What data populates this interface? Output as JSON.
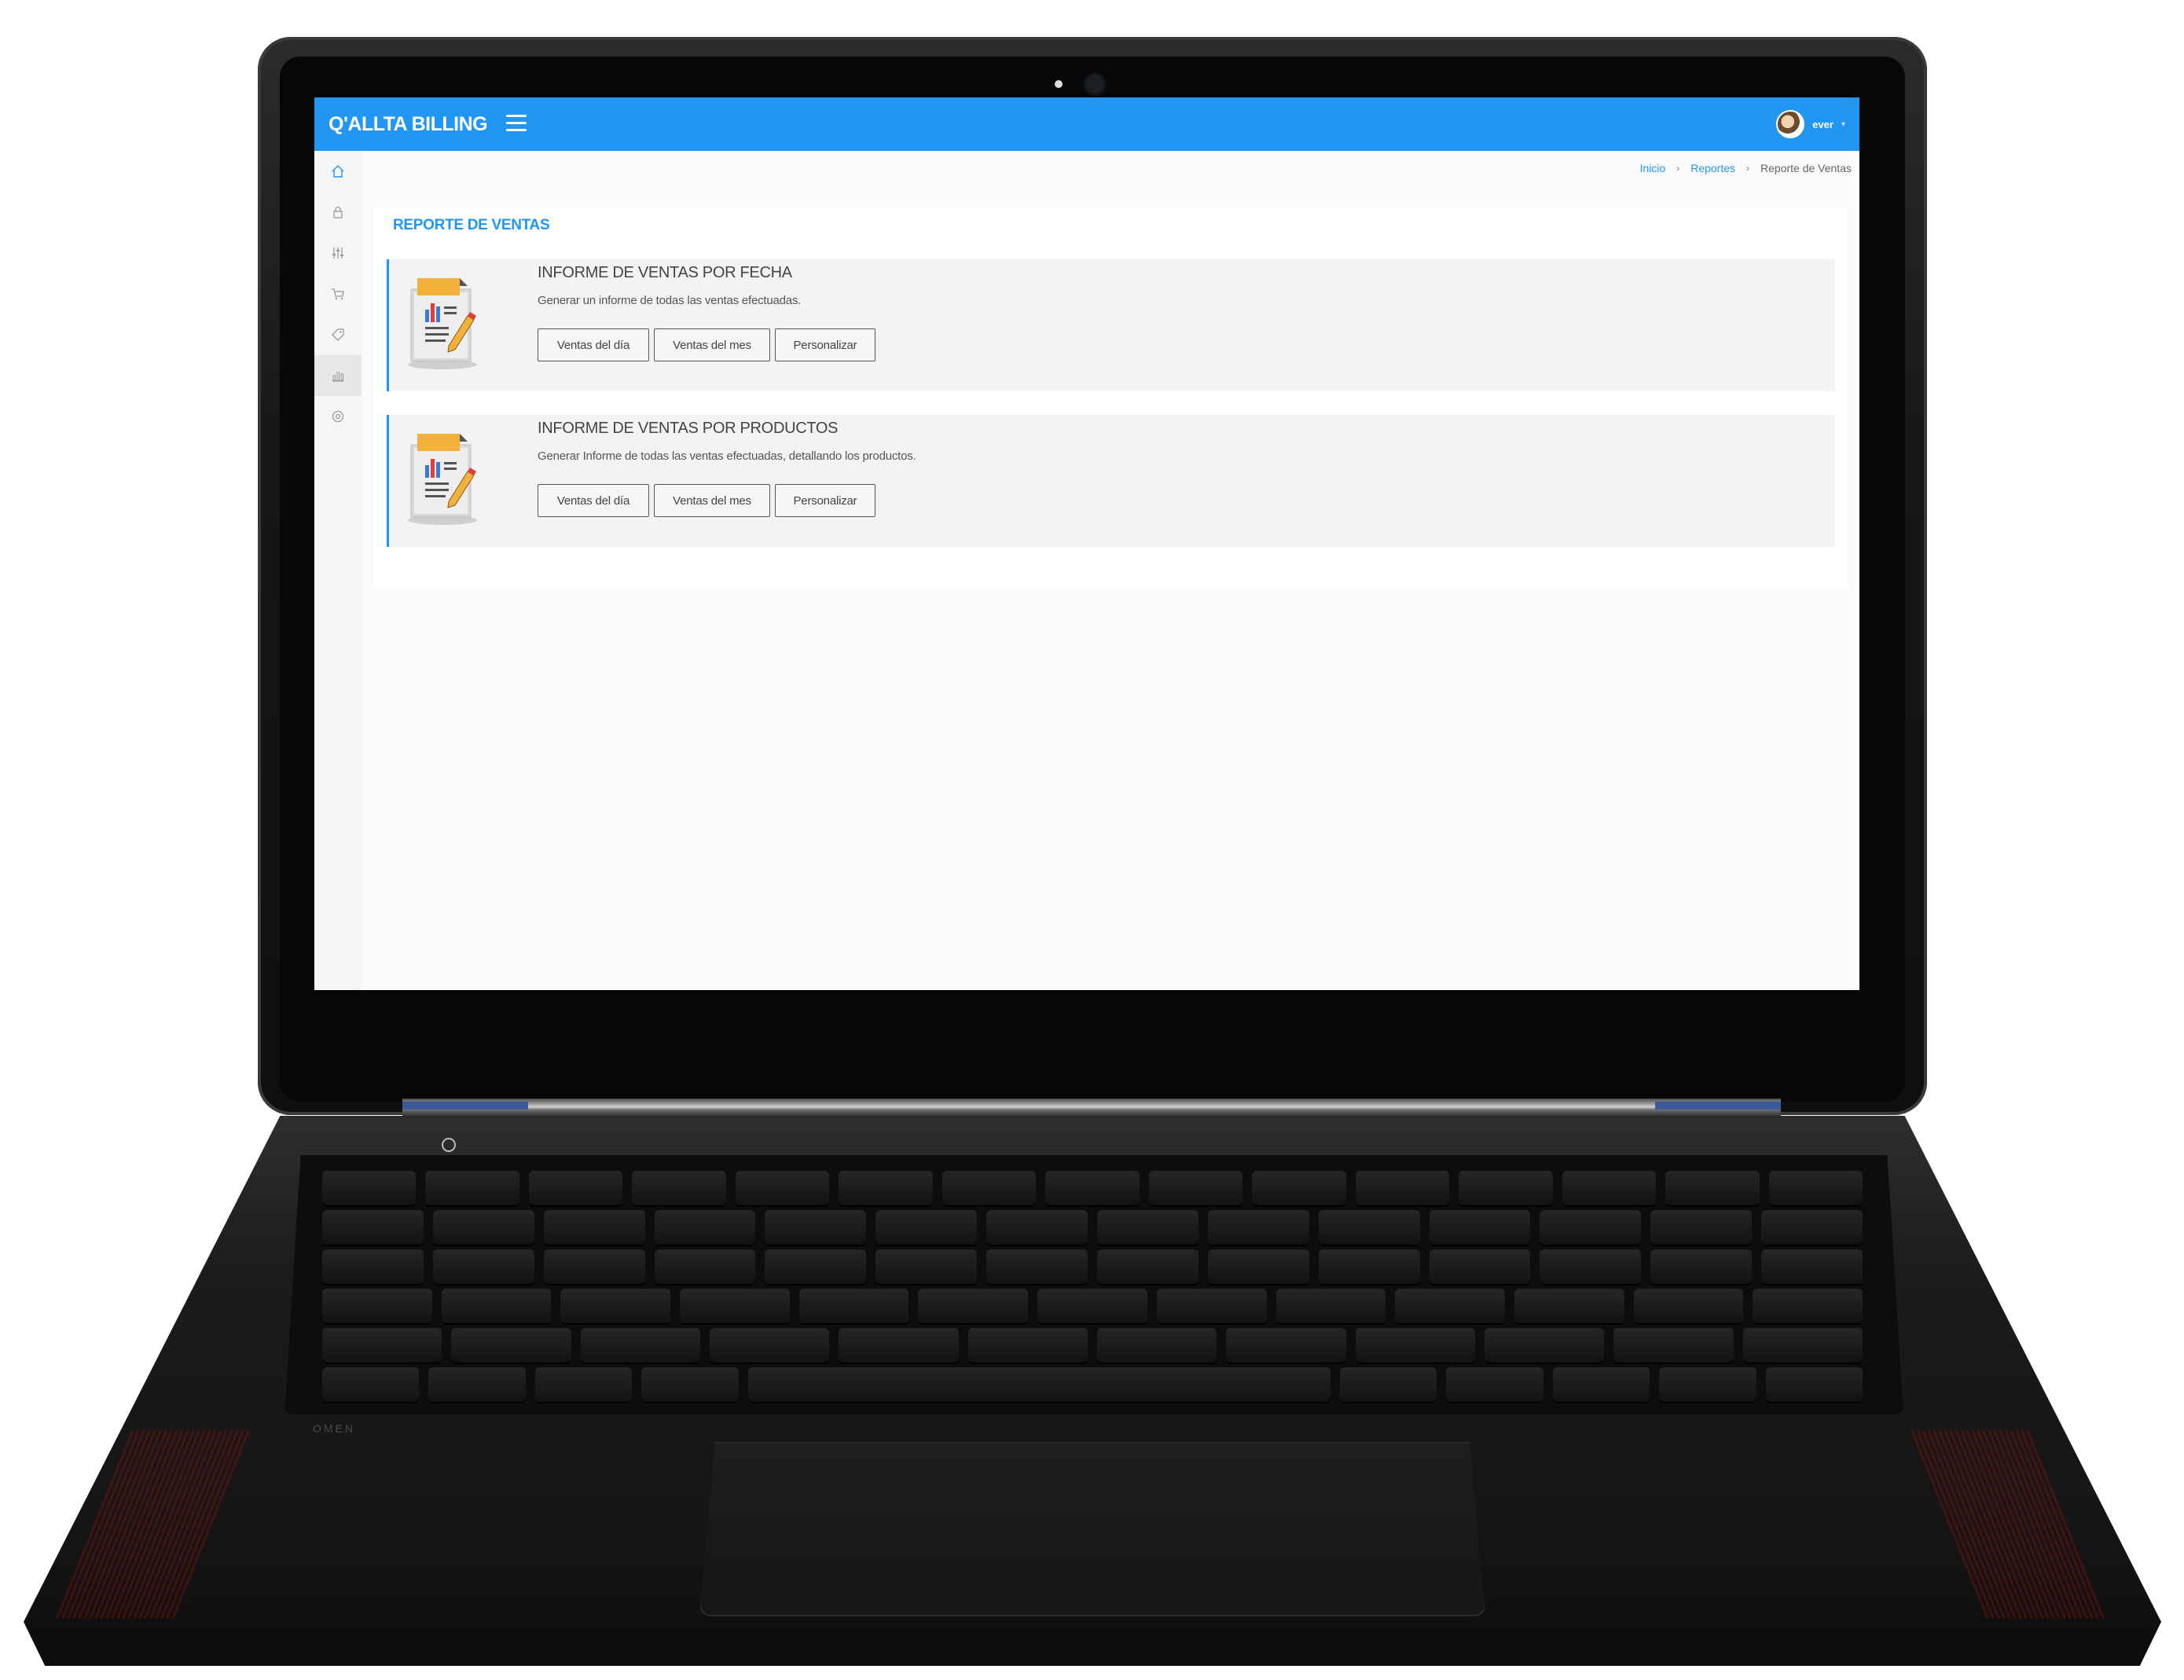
{
  "app": {
    "brand": "Q'ALLTA BILLING",
    "user_name": "ever",
    "caret": "▾"
  },
  "sidebar": {
    "items": [
      {
        "icon": "home-icon"
      },
      {
        "icon": "lock-icon"
      },
      {
        "icon": "sliders-icon"
      },
      {
        "icon": "cart-icon"
      },
      {
        "icon": "tag-icon"
      },
      {
        "icon": "bar-chart-icon",
        "active": true
      },
      {
        "icon": "settings-icon"
      }
    ]
  },
  "breadcrumb": {
    "items": [
      "Inicio",
      "Reportes",
      "Reporte de Ventas"
    ],
    "separator": "›"
  },
  "page": {
    "title": "REPORTE DE VENTAS"
  },
  "reports": [
    {
      "title": "INFORME DE VENTAS POR FECHA",
      "description": "Generar un informe de todas las ventas efectuadas.",
      "buttons": [
        "Ventas del día",
        "Ventas del mes",
        "Personalizar"
      ]
    },
    {
      "title": "INFORME DE VENTAS POR PRODUCTOS",
      "description": "Generar Informe de todas las ventas efectuadas, detallando los productos.",
      "buttons": [
        "Ventas del día",
        "Ventas del mes",
        "Personalizar"
      ]
    }
  ],
  "device": {
    "brand_mark": "OMEN"
  },
  "colors": {
    "accent": "#2196f3",
    "keyboard_backlight": "#b11818"
  }
}
